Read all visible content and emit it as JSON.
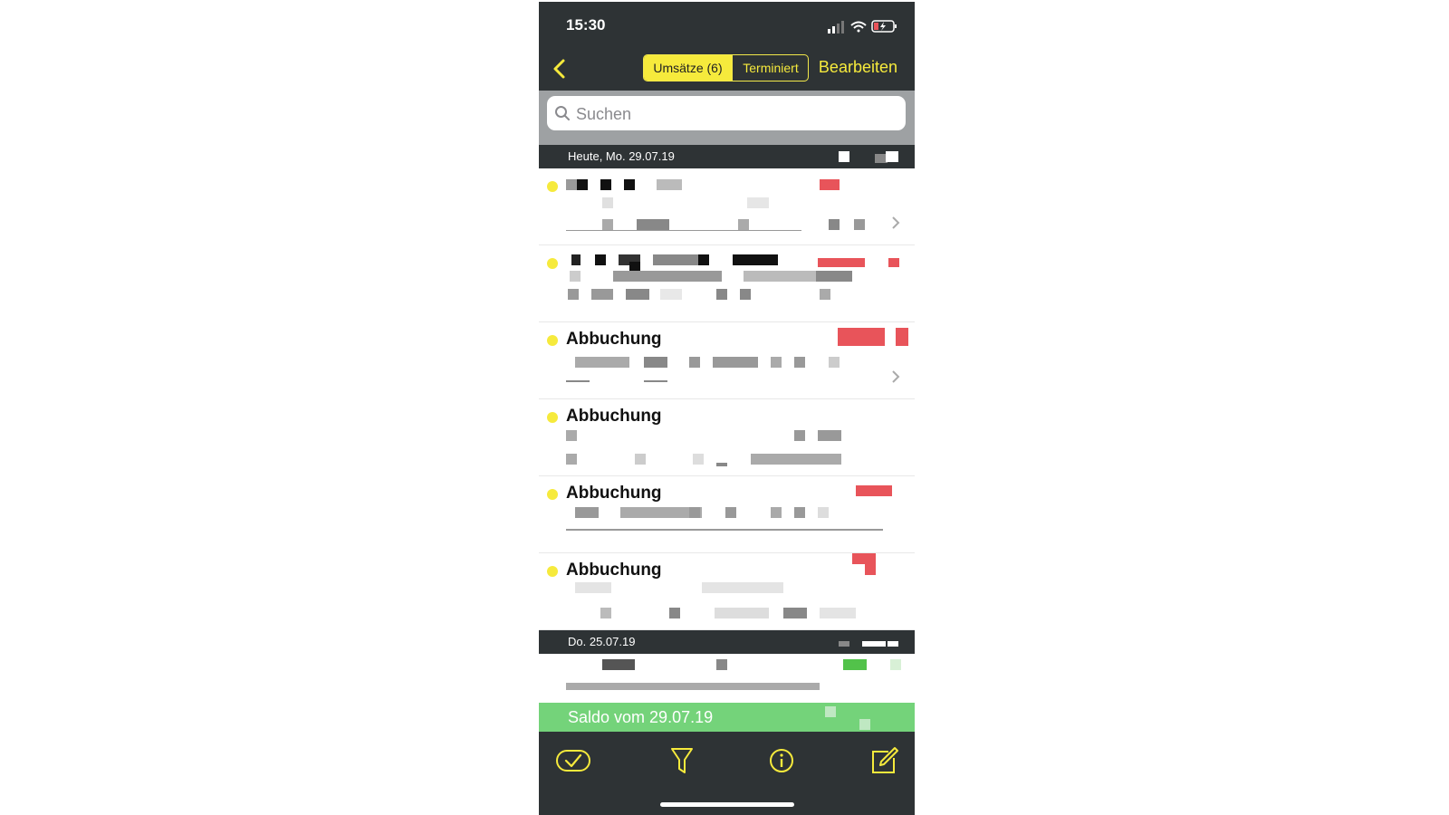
{
  "status_bar": {
    "time": "15:30"
  },
  "nav": {
    "segments": [
      {
        "label": "Umsätze (6)",
        "selected": true
      },
      {
        "label": "Terminiert",
        "selected": false
      }
    ],
    "edit_label": "Bearbeiten"
  },
  "search": {
    "placeholder": "Suchen"
  },
  "sections": [
    {
      "date_label": "Heute, Mo. 29.07.19"
    },
    {
      "date_label": "Do. 25.07.19"
    }
  ],
  "transactions": [
    {
      "title": ""
    },
    {
      "title": ""
    },
    {
      "title": "Abbuchung"
    },
    {
      "title": "Abbuchung"
    },
    {
      "title": "Abbuchung"
    },
    {
      "title": "Abbuchung"
    }
  ],
  "balance": {
    "label": "Saldo vom 29.07.19"
  },
  "toolbar": {
    "icons": [
      "checkmark-oval-icon",
      "filter-icon",
      "info-icon",
      "compose-icon"
    ]
  },
  "colors": {
    "bar_dark": "#2e3335",
    "accent_yellow": "#f6ea3c",
    "balance_green": "#74d37a",
    "amount_red": "#e8545a"
  }
}
